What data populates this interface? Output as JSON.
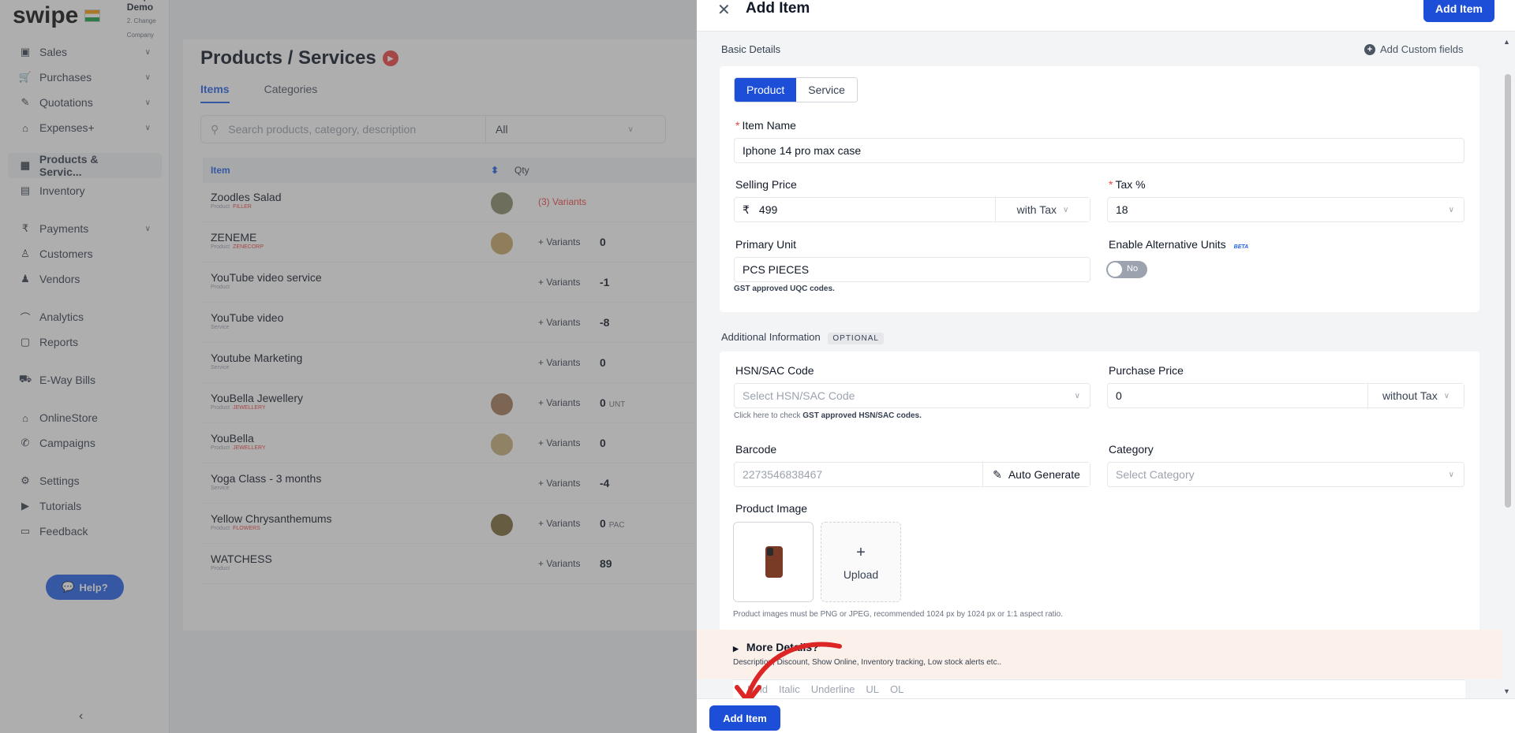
{
  "brand": {
    "logo": "swipe",
    "org_name": "Swipe Demo",
    "org_sub": "2. Change Company"
  },
  "sidebar": {
    "groups": [
      [
        {
          "icon": "sales-icon",
          "label": "Sales",
          "chev": true
        },
        {
          "icon": "cart-icon",
          "label": "Purchases",
          "chev": true
        },
        {
          "icon": "pen-icon",
          "label": "Quotations",
          "chev": true
        },
        {
          "icon": "tag-icon",
          "label": "Expenses+",
          "chev": true
        }
      ],
      [
        {
          "icon": "box-icon",
          "label": "Products & Servic...",
          "active": true
        },
        {
          "icon": "warehouse-icon",
          "label": "Inventory"
        }
      ],
      [
        {
          "icon": "rupee-icon",
          "label": "Payments",
          "chev": true
        },
        {
          "icon": "user-icon",
          "label": "Customers"
        },
        {
          "icon": "users-icon",
          "label": "Vendors"
        }
      ],
      [
        {
          "icon": "chart-icon",
          "label": "Analytics"
        },
        {
          "icon": "report-icon",
          "label": "Reports"
        }
      ],
      [
        {
          "icon": "truck-icon",
          "label": "E-Way Bills"
        }
      ],
      [
        {
          "icon": "store-icon",
          "label": "OnlineStore"
        },
        {
          "icon": "megaphone-icon",
          "label": "Campaigns"
        }
      ],
      [
        {
          "icon": "gear-icon",
          "label": "Settings"
        },
        {
          "icon": "youtube-icon",
          "label": "Tutorials"
        },
        {
          "icon": "chat-icon",
          "label": "Feedback"
        }
      ]
    ],
    "help_label": "Help?",
    "collapse": "‹"
  },
  "main": {
    "title": "Products / Services",
    "tabs": [
      "Items",
      "Categories"
    ],
    "search_placeholder": "Search products, category, description",
    "filter_value": "All",
    "col_item": "Item",
    "col_qty": "Qty",
    "rows": [
      {
        "name": "Zoodles Salad",
        "type": "Product",
        "tag": "FILLER",
        "thumb": "#8b8b6b",
        "variants": "(3) Variants",
        "red": true,
        "qty": "",
        "unit": ""
      },
      {
        "name": "ZENEME",
        "type": "Product",
        "tag": "ZENECORP",
        "thumb": "#c9a66b",
        "variants": "+ Variants",
        "red": false,
        "qty": "0",
        "unit": ""
      },
      {
        "name": "YouTube video service",
        "type": "Product",
        "tag": "",
        "thumb": "",
        "variants": "+ Variants",
        "red": false,
        "qty": "-1",
        "unit": ""
      },
      {
        "name": "YouTube video",
        "type": "Service",
        "tag": "",
        "thumb": "",
        "variants": "+ Variants",
        "red": false,
        "qty": "-8",
        "unit": ""
      },
      {
        "name": "Youtube Marketing",
        "type": "Service",
        "tag": "",
        "thumb": "",
        "variants": "+ Variants",
        "red": false,
        "qty": "0",
        "unit": ""
      },
      {
        "name": "YouBella Jewellery",
        "type": "Product",
        "tag": "JEWELLERY",
        "thumb": "#a67b5b",
        "variants": "+ Variants",
        "red": false,
        "qty": "0",
        "unit": "UNT"
      },
      {
        "name": "YouBella",
        "type": "Product",
        "tag": "JEWELLERY",
        "thumb": "#c8b07a",
        "variants": "+ Variants",
        "red": false,
        "qty": "0",
        "unit": ""
      },
      {
        "name": "Yoga Class - 3 months",
        "type": "Service",
        "tag": "",
        "thumb": "",
        "variants": "+ Variants",
        "red": false,
        "qty": "-4",
        "unit": ""
      },
      {
        "name": "Yellow Chrysanthemums",
        "type": "Product",
        "tag": "FLOWERS",
        "thumb": "#7a6a3a",
        "variants": "+ Variants",
        "red": false,
        "qty": "0",
        "unit": "PAC"
      },
      {
        "name": "WATCHESS",
        "type": "Product",
        "tag": "",
        "thumb": "",
        "variants": "+ Variants",
        "red": false,
        "qty": "89",
        "unit": ""
      }
    ]
  },
  "drawer": {
    "title": "Add Item",
    "add_button": "Add Item",
    "basic_details": "Basic Details",
    "add_custom_fields": "Add Custom fields",
    "type_options": [
      "Product",
      "Service"
    ],
    "item_name_label": "Item Name",
    "item_name_value": "Iphone 14 pro max case",
    "selling_price_label": "Selling Price",
    "currency": "₹",
    "selling_price_value": "499",
    "selling_tax_mode": "with Tax",
    "tax_label": "Tax %",
    "tax_value": "18",
    "primary_unit_label": "Primary Unit",
    "primary_unit_value": "PCS PIECES",
    "uqc_hint": "GST approved UQC codes.",
    "alt_units_label": "Enable Alternative Units",
    "beta": "BETA",
    "toggle_text": "No",
    "additional_info": "Additional Information",
    "optional": "OPTIONAL",
    "hsn_label": "HSN/SAC Code",
    "hsn_placeholder": "Select HSN/SAC Code",
    "hsn_hint_pre": "Click here to check ",
    "hsn_hint_bold": "GST approved HSN/SAC codes.",
    "purchase_price_label": "Purchase Price",
    "purchase_price_value": "0",
    "purchase_tax_mode": "without Tax",
    "barcode_label": "Barcode",
    "barcode_placeholder": "2273546838467",
    "auto_generate": "Auto Generate",
    "category_label": "Category",
    "category_placeholder": "Select Category",
    "product_image_label": "Product Image",
    "upload_label": "Upload",
    "image_hint": "Product images must be PNG or JPEG, recommended 1024 px by 1024 px or 1:1 aspect ratio.",
    "more_details_title": "More Details?",
    "more_details_sub": "Description, Discount, Show Online, Inventory tracking, Low stock alerts etc..",
    "editor_tools": [
      "Bold",
      "Italic",
      "Underline",
      "UL",
      "OL"
    ],
    "footer_add": "Add Item"
  }
}
